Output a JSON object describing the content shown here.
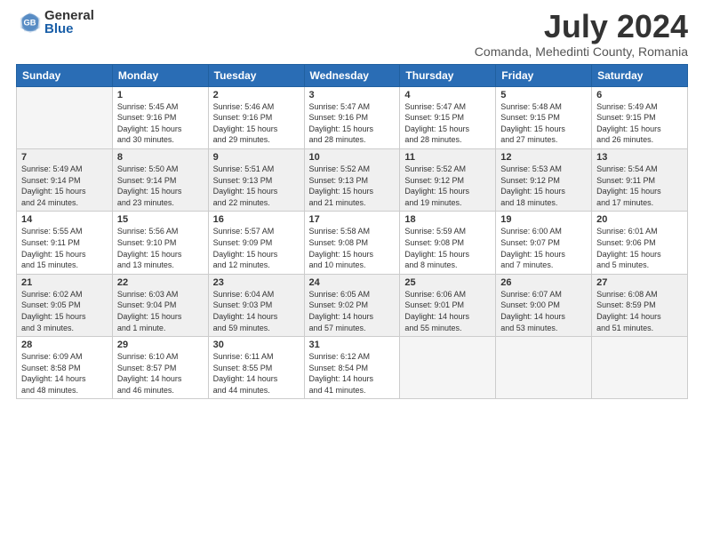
{
  "header": {
    "logo_general": "General",
    "logo_blue": "Blue",
    "month_year": "July 2024",
    "location": "Comanda, Mehedinti County, Romania"
  },
  "days_of_week": [
    "Sunday",
    "Monday",
    "Tuesday",
    "Wednesday",
    "Thursday",
    "Friday",
    "Saturday"
  ],
  "weeks": [
    [
      {
        "day": "",
        "info": ""
      },
      {
        "day": "1",
        "info": "Sunrise: 5:45 AM\nSunset: 9:16 PM\nDaylight: 15 hours\nand 30 minutes."
      },
      {
        "day": "2",
        "info": "Sunrise: 5:46 AM\nSunset: 9:16 PM\nDaylight: 15 hours\nand 29 minutes."
      },
      {
        "day": "3",
        "info": "Sunrise: 5:47 AM\nSunset: 9:16 PM\nDaylight: 15 hours\nand 28 minutes."
      },
      {
        "day": "4",
        "info": "Sunrise: 5:47 AM\nSunset: 9:15 PM\nDaylight: 15 hours\nand 28 minutes."
      },
      {
        "day": "5",
        "info": "Sunrise: 5:48 AM\nSunset: 9:15 PM\nDaylight: 15 hours\nand 27 minutes."
      },
      {
        "day": "6",
        "info": "Sunrise: 5:49 AM\nSunset: 9:15 PM\nDaylight: 15 hours\nand 26 minutes."
      }
    ],
    [
      {
        "day": "7",
        "info": "Sunrise: 5:49 AM\nSunset: 9:14 PM\nDaylight: 15 hours\nand 24 minutes."
      },
      {
        "day": "8",
        "info": "Sunrise: 5:50 AM\nSunset: 9:14 PM\nDaylight: 15 hours\nand 23 minutes."
      },
      {
        "day": "9",
        "info": "Sunrise: 5:51 AM\nSunset: 9:13 PM\nDaylight: 15 hours\nand 22 minutes."
      },
      {
        "day": "10",
        "info": "Sunrise: 5:52 AM\nSunset: 9:13 PM\nDaylight: 15 hours\nand 21 minutes."
      },
      {
        "day": "11",
        "info": "Sunrise: 5:52 AM\nSunset: 9:12 PM\nDaylight: 15 hours\nand 19 minutes."
      },
      {
        "day": "12",
        "info": "Sunrise: 5:53 AM\nSunset: 9:12 PM\nDaylight: 15 hours\nand 18 minutes."
      },
      {
        "day": "13",
        "info": "Sunrise: 5:54 AM\nSunset: 9:11 PM\nDaylight: 15 hours\nand 17 minutes."
      }
    ],
    [
      {
        "day": "14",
        "info": "Sunrise: 5:55 AM\nSunset: 9:11 PM\nDaylight: 15 hours\nand 15 minutes."
      },
      {
        "day": "15",
        "info": "Sunrise: 5:56 AM\nSunset: 9:10 PM\nDaylight: 15 hours\nand 13 minutes."
      },
      {
        "day": "16",
        "info": "Sunrise: 5:57 AM\nSunset: 9:09 PM\nDaylight: 15 hours\nand 12 minutes."
      },
      {
        "day": "17",
        "info": "Sunrise: 5:58 AM\nSunset: 9:08 PM\nDaylight: 15 hours\nand 10 minutes."
      },
      {
        "day": "18",
        "info": "Sunrise: 5:59 AM\nSunset: 9:08 PM\nDaylight: 15 hours\nand 8 minutes."
      },
      {
        "day": "19",
        "info": "Sunrise: 6:00 AM\nSunset: 9:07 PM\nDaylight: 15 hours\nand 7 minutes."
      },
      {
        "day": "20",
        "info": "Sunrise: 6:01 AM\nSunset: 9:06 PM\nDaylight: 15 hours\nand 5 minutes."
      }
    ],
    [
      {
        "day": "21",
        "info": "Sunrise: 6:02 AM\nSunset: 9:05 PM\nDaylight: 15 hours\nand 3 minutes."
      },
      {
        "day": "22",
        "info": "Sunrise: 6:03 AM\nSunset: 9:04 PM\nDaylight: 15 hours\nand 1 minute."
      },
      {
        "day": "23",
        "info": "Sunrise: 6:04 AM\nSunset: 9:03 PM\nDaylight: 14 hours\nand 59 minutes."
      },
      {
        "day": "24",
        "info": "Sunrise: 6:05 AM\nSunset: 9:02 PM\nDaylight: 14 hours\nand 57 minutes."
      },
      {
        "day": "25",
        "info": "Sunrise: 6:06 AM\nSunset: 9:01 PM\nDaylight: 14 hours\nand 55 minutes."
      },
      {
        "day": "26",
        "info": "Sunrise: 6:07 AM\nSunset: 9:00 PM\nDaylight: 14 hours\nand 53 minutes."
      },
      {
        "day": "27",
        "info": "Sunrise: 6:08 AM\nSunset: 8:59 PM\nDaylight: 14 hours\nand 51 minutes."
      }
    ],
    [
      {
        "day": "28",
        "info": "Sunrise: 6:09 AM\nSunset: 8:58 PM\nDaylight: 14 hours\nand 48 minutes."
      },
      {
        "day": "29",
        "info": "Sunrise: 6:10 AM\nSunset: 8:57 PM\nDaylight: 14 hours\nand 46 minutes."
      },
      {
        "day": "30",
        "info": "Sunrise: 6:11 AM\nSunset: 8:55 PM\nDaylight: 14 hours\nand 44 minutes."
      },
      {
        "day": "31",
        "info": "Sunrise: 6:12 AM\nSunset: 8:54 PM\nDaylight: 14 hours\nand 41 minutes."
      },
      {
        "day": "",
        "info": ""
      },
      {
        "day": "",
        "info": ""
      },
      {
        "day": "",
        "info": ""
      }
    ]
  ]
}
